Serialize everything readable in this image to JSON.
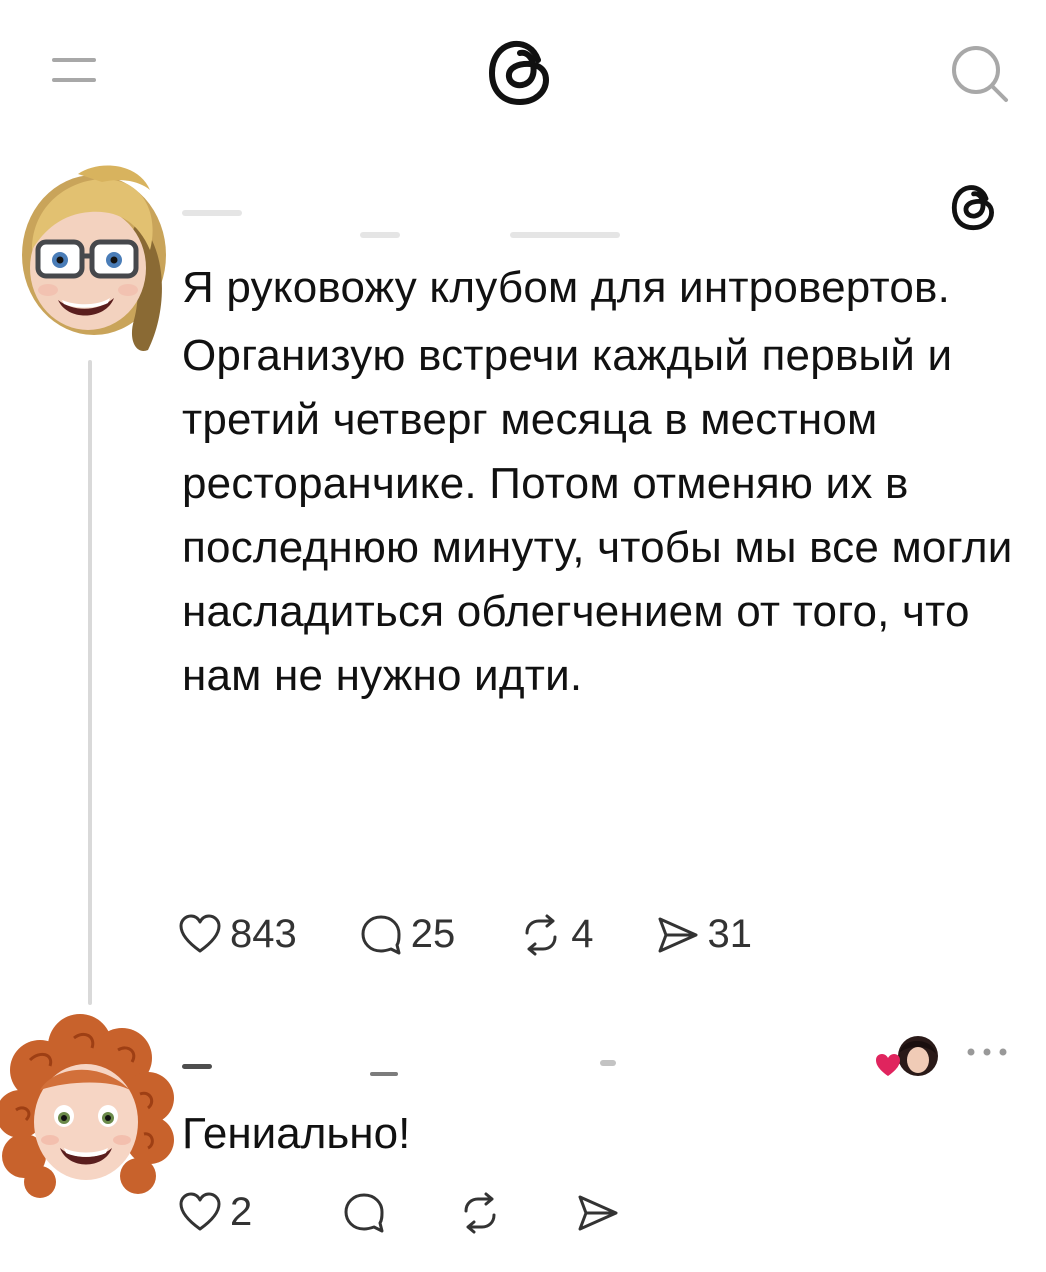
{
  "header": {
    "menu_icon": "menu-icon",
    "logo_icon": "threads-logo-icon",
    "search_icon": "search-icon"
  },
  "post": {
    "avatar": "memoji-avatar-blonde",
    "logo_icon": "threads-logo-icon",
    "paragraph1": "Я руковожу клубом для интровертов.",
    "paragraph2": "Организую встречи каждый первый и третий четверг месяца в местном ресторанчике. Потом отменяю их в последнюю минуту, чтобы мы все могли насладиться облегчением от того, что нам не нужно идти.",
    "likes": "843",
    "comments": "25",
    "reposts": "4",
    "shares": "31"
  },
  "reply": {
    "avatar": "memoji-avatar-redhead",
    "text": "Гениально!",
    "likes": "2",
    "liked_by_author_icon": "liked-by-author-icon",
    "more_icon": "more-icon"
  },
  "colors": {
    "text": "#111111",
    "secondary": "#333333",
    "thread_line": "#d9d9d9",
    "heart": "#e0245e"
  }
}
